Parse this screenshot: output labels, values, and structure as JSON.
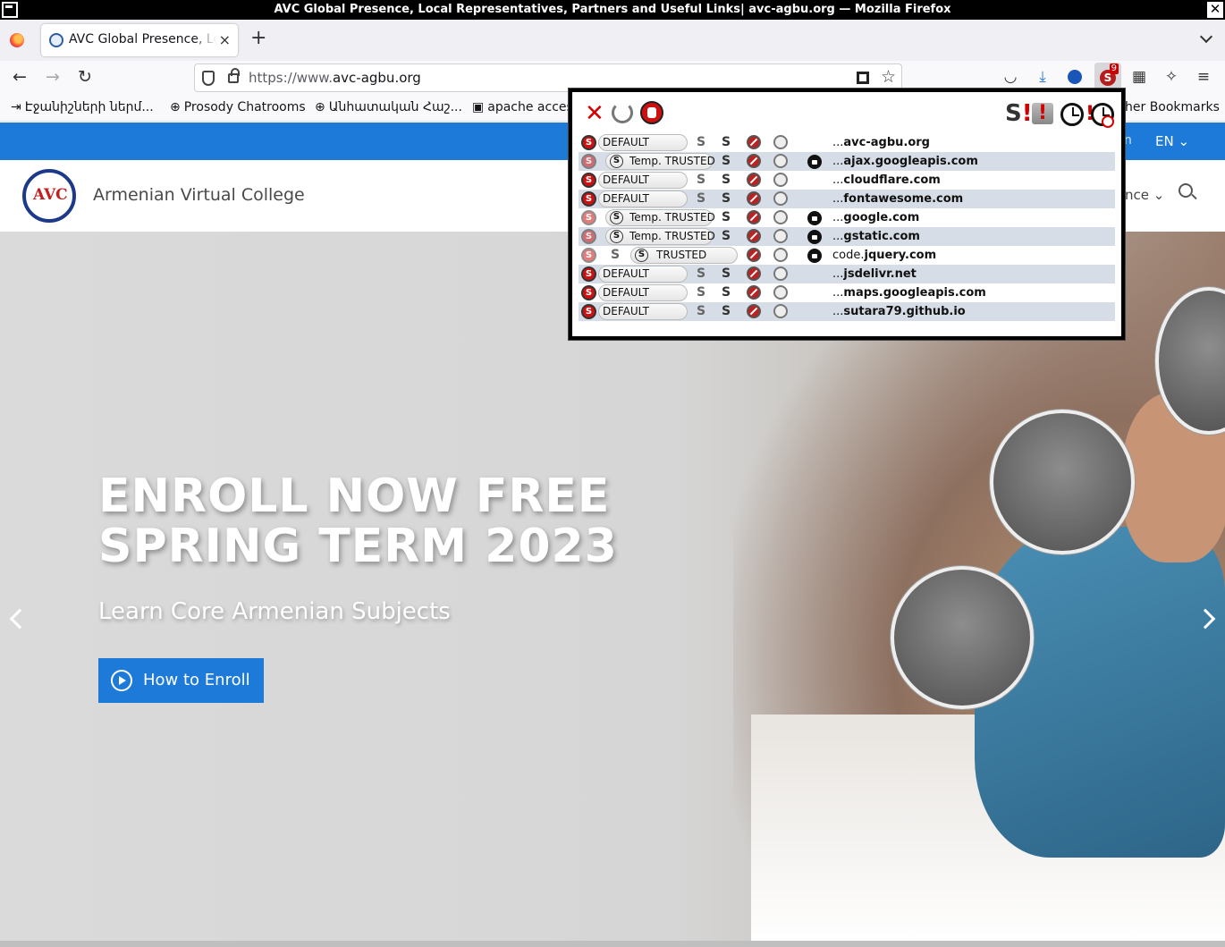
{
  "window": {
    "title": "AVC Global Presence, Local Representatives, Partners and Useful Links| avc-agbu.org — Mozilla Firefox"
  },
  "tabs": [
    {
      "title": "AVC Global Presence, Local Representatives, Partners and Useful Links| avc-agbu.org",
      "close": "×"
    }
  ],
  "toolbar": {
    "new_tab": "+",
    "back": "←",
    "forward": "→",
    "reload": "↻",
    "url_scheme": "https://www.",
    "url_host": "avc-agbu.org",
    "star": "☆",
    "noscript_badge": "9",
    "menu": "≡"
  },
  "bookmarks": [
    {
      "icon": "login-icon",
      "glyph": "⇥",
      "label": "Էջանիշների ներմ..."
    },
    {
      "icon": "globe-icon",
      "glyph": "⊕",
      "label": "Prosody Chatrooms"
    },
    {
      "icon": "globe-icon",
      "glyph": "⊕",
      "label": "Անհատական Հաշ..."
    },
    {
      "icon": "book-icon",
      "glyph": "▣",
      "label": "apache access"
    },
    {
      "icon": "folder-icon",
      "glyph": "",
      "label": "her Bookmarks"
    }
  ],
  "site": {
    "lang": "EN",
    "lang_partial": "n",
    "name": "Armenian Virtual College",
    "logo_text": "AVC",
    "menu_partial": "nce",
    "hero_title_1": "ENROLL NOW FREE",
    "hero_title_2": "SPRING TERM 2023",
    "hero_subtitle": "Learn Core Armenian Subjects",
    "enroll_button": "How to Enroll",
    "accent_color": "#1d7ad9"
  },
  "noscript": {
    "close_glyph": "✕",
    "warn_glyph": "S",
    "bang": "!",
    "rows": [
      {
        "preset": "DEFAULT",
        "kind": "default",
        "prefix": "...",
        "domain": "avc-agbu.org",
        "lock": false
      },
      {
        "preset": "Temp. TRUSTED",
        "kind": "temp",
        "prefix": "...",
        "domain": "ajax.googleapis.com",
        "lock": true
      },
      {
        "preset": "DEFAULT",
        "kind": "default",
        "prefix": "...",
        "domain": "cloudflare.com",
        "lock": false
      },
      {
        "preset": "DEFAULT",
        "kind": "default",
        "prefix": "...",
        "domain": "fontawesome.com",
        "lock": false
      },
      {
        "preset": "Temp. TRUSTED",
        "kind": "temp",
        "prefix": "...",
        "domain": "google.com",
        "lock": true
      },
      {
        "preset": "Temp. TRUSTED",
        "kind": "temp",
        "prefix": "...",
        "domain": "gstatic.com",
        "lock": true
      },
      {
        "preset": "TRUSTED",
        "kind": "trusted",
        "prefix": "code.",
        "domain": "jquery.com",
        "lock": true
      },
      {
        "preset": "DEFAULT",
        "kind": "default",
        "prefix": "...",
        "domain": "jsdelivr.net",
        "lock": false
      },
      {
        "preset": "DEFAULT",
        "kind": "default",
        "prefix": "...",
        "domain": "maps.googleapis.com",
        "lock": false
      },
      {
        "preset": "DEFAULT",
        "kind": "default",
        "prefix": "...",
        "domain": "sutara79.github.io",
        "lock": false
      }
    ]
  }
}
